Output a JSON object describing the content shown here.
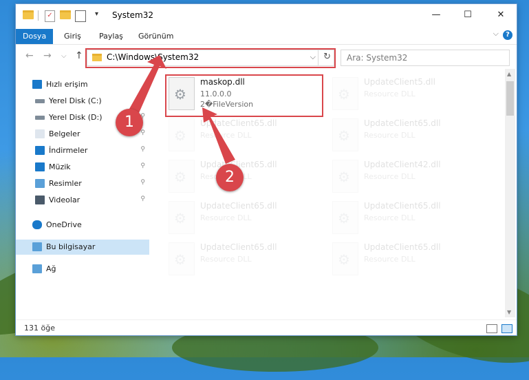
{
  "window": {
    "title": "System32",
    "buttons": {
      "minimize": "—",
      "maximize": "☐",
      "close": "✕"
    }
  },
  "ribbon": {
    "tabs": [
      "Dosya",
      "Giriş",
      "Paylaş",
      "Görünüm"
    ],
    "help": "?",
    "collapse": "⌵"
  },
  "address": {
    "path": "C:\\Windows\\System32",
    "dropdown": "⌵",
    "refresh": "↻"
  },
  "nav_buttons": {
    "back": "←",
    "forward": "→",
    "recent": "⌵",
    "up": "↑"
  },
  "search": {
    "placeholder": "Ara: System32"
  },
  "sidebar": {
    "items": [
      {
        "label": "Hızlı erişim",
        "icon": "star-icon",
        "pinned": false
      },
      {
        "label": "Yerel Disk (C:)",
        "icon": "drive-icon",
        "pinned": true
      },
      {
        "label": "Yerel Disk (D:)",
        "icon": "drive-icon",
        "pinned": true
      },
      {
        "label": "Belgeler",
        "icon": "documents-icon",
        "pinned": true
      },
      {
        "label": "İndirmeler",
        "icon": "download-icon",
        "pinned": true
      },
      {
        "label": "Müzik",
        "icon": "music-icon",
        "pinned": true
      },
      {
        "label": "Resimler",
        "icon": "pictures-icon",
        "pinned": true
      },
      {
        "label": "Videolar",
        "icon": "videos-icon",
        "pinned": true
      },
      {
        "label": "OneDrive",
        "icon": "cloud-icon",
        "pinned": false
      },
      {
        "label": "Bu bilgisayar",
        "icon": "computer-icon",
        "pinned": false,
        "selected": true
      },
      {
        "label": "Ağ",
        "icon": "network-icon",
        "pinned": false
      }
    ],
    "pin_glyph": "📌"
  },
  "files": [
    {
      "name": "maskop.dll",
      "line2": "11.0.0.0",
      "line3": "2�FileVersion",
      "highlighted": true
    },
    {
      "name": "UpdateClient5.dll",
      "line2": "Resource DLL"
    },
    {
      "name": "UpdateClient65.dll",
      "line2": "Resource DLL"
    },
    {
      "name": "UpdateClient65.dll",
      "line2": "Resource DLL"
    },
    {
      "name": "UpdateClient65.dll",
      "line2": "Resource DLL"
    },
    {
      "name": "UpdateClient42.dll",
      "line2": "Resource DLL"
    },
    {
      "name": "UpdateClient65.dll",
      "line2": "Resource DLL"
    },
    {
      "name": "UpdateClient65.dll",
      "line2": "Resource DLL"
    },
    {
      "name": "UpdateClient65.dll",
      "line2": "Resource DLL"
    },
    {
      "name": "UpdateClient65.dll",
      "line2": "Resource DLL"
    }
  ],
  "status": {
    "count": "131 öğe"
  },
  "callouts": {
    "one": "1",
    "two": "2"
  },
  "colors": {
    "accent": "#1979ca",
    "highlight": "#d9464b",
    "selected": "#cce4f7"
  }
}
